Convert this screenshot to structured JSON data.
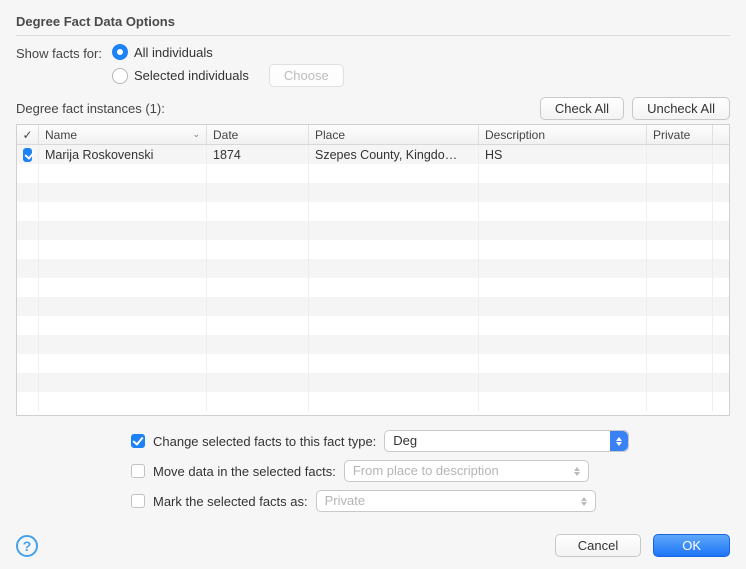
{
  "title": "Degree Fact Data Options",
  "showFactsFor": {
    "label": "Show facts for:",
    "allLabel": "All individuals",
    "selectedLabel": "Selected individuals",
    "chooseLabel": "Choose",
    "selected": "all"
  },
  "instancesLabel": "Degree fact instances (1):",
  "buttons": {
    "checkAll": "Check All",
    "uncheckAll": "Uncheck All",
    "cancel": "Cancel",
    "ok": "OK"
  },
  "columns": {
    "check": "✓",
    "name": "Name",
    "date": "Date",
    "place": "Place",
    "description": "Description",
    "private": "Private"
  },
  "rows": [
    {
      "checked": true,
      "name": "Marija Roskovenski",
      "date": "1874",
      "place": "Szepes County, Kingdo…",
      "description": "HS",
      "private": ""
    }
  ],
  "options": {
    "changeType": {
      "checked": true,
      "label": "Change selected facts to this fact type:",
      "value": "Deg"
    },
    "moveData": {
      "checked": false,
      "label": "Move data in the selected facts:",
      "value": "From place to description"
    },
    "markAs": {
      "checked": false,
      "label": "Mark the selected facts as:",
      "value": "Private"
    }
  }
}
